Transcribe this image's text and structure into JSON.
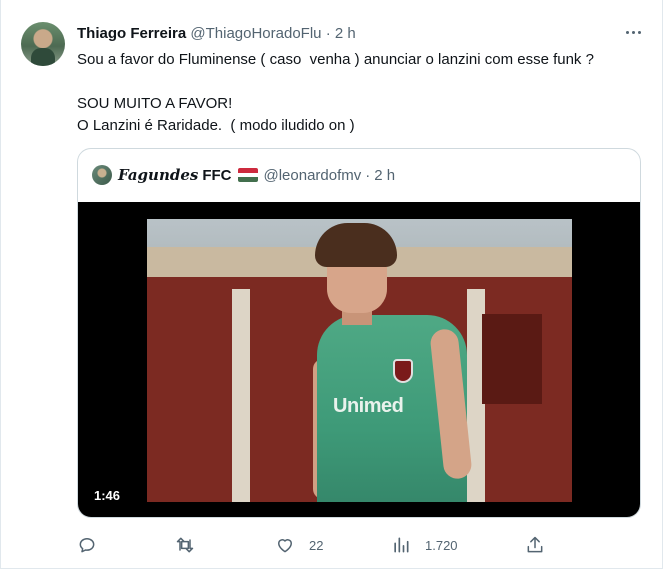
{
  "tweet": {
    "author_name": "Thiago Ferreira",
    "author_handle": "@ThiagoHoradoFlu",
    "separator": "·",
    "time": "2 h",
    "lines": [
      "Sou a favor do Fluminense ( caso  venha ) anunciar o lanzini com esse funk ?",
      "",
      "SOU MUITO A FAVOR!",
      "O Lanzini é Raridade.  ( modo iludido on )"
    ]
  },
  "quote": {
    "author_name": "Fagundes",
    "author_suffix": "FFC",
    "flag_colors": [
      "#7a1a1a",
      "#ffffff",
      "#1f7a4a"
    ],
    "author_handle": "@leonardofmv",
    "separator": "·",
    "time": "2 h",
    "video": {
      "duration": "1:46",
      "shirt_sponsor": "Unimed"
    }
  },
  "actions": {
    "reply_icon": "reply-icon",
    "retweet_icon": "retweet-icon",
    "like_icon": "heart-icon",
    "like_count": "22",
    "views_icon": "views-icon",
    "views_count": "1.720",
    "share_icon": "share-icon"
  },
  "colors": {
    "text": "#0f1419",
    "secondary": "#536471",
    "border": "#cfd9de"
  }
}
